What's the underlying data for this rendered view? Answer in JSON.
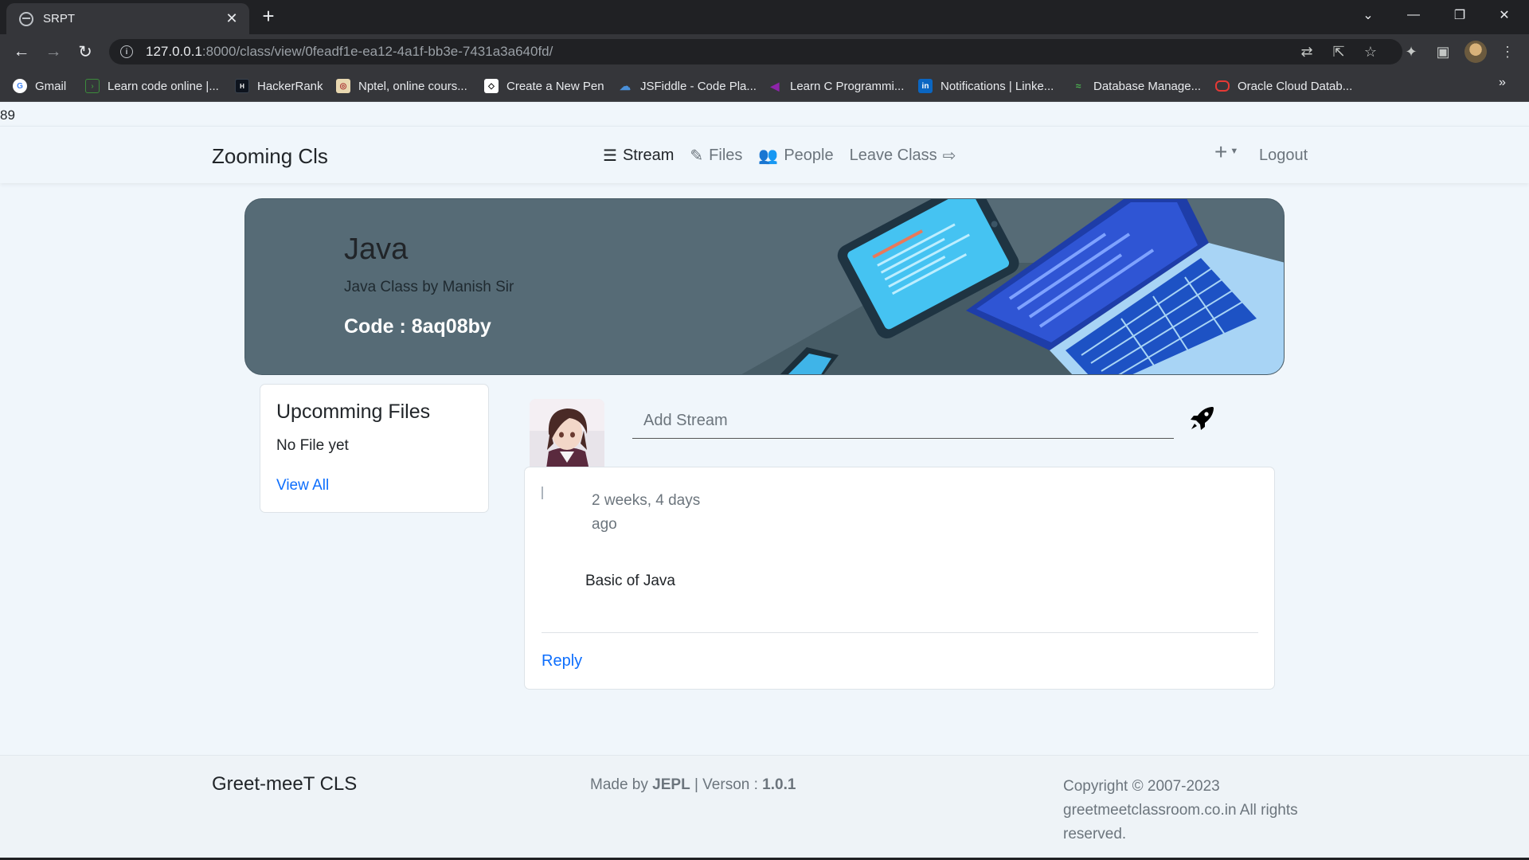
{
  "browser": {
    "tab_title": "SRPT",
    "tab_close": "✕",
    "new_tab": "+",
    "url_host": "127.0.0.1",
    "url_rest": ":8000/class/view/0feadf1e-ea12-4a1f-bb3e-7431a3a640fd/",
    "bookmarks": [
      {
        "label": "Gmail",
        "icon": "google-icon",
        "color": "#ffffff"
      },
      {
        "label": "Learn code online |...",
        "icon": "code-icon",
        "color": "#3c8c3c"
      },
      {
        "label": "HackerRank",
        "icon": "hackerrank-icon",
        "color": "#0e141e"
      },
      {
        "label": "Nptel, online cours...",
        "icon": "nptel-icon",
        "color": "#e8d7b0"
      },
      {
        "label": "Create a New Pen",
        "icon": "codepen-icon",
        "color": "#ffffff"
      },
      {
        "label": "JSFiddle - Code Pla...",
        "icon": "jsfiddle-icon",
        "color": "#1c75bc"
      },
      {
        "label": "Learn C Programmi...",
        "icon": "programiz-icon",
        "color": "#7b1fa2"
      },
      {
        "label": "Notifications | Linke...",
        "icon": "linkedin-icon",
        "color": "#0a66c2"
      },
      {
        "label": "Database Manage...",
        "icon": "database-icon",
        "color": "#4caf50"
      },
      {
        "label": "Oracle Cloud Datab...",
        "icon": "oracle-icon",
        "color": "#e53935"
      }
    ]
  },
  "stray_text": "89",
  "nav": {
    "brand": "Zooming Cls",
    "links": [
      {
        "label": "Stream",
        "icon": "bars-icon"
      },
      {
        "label": "Files",
        "icon": "file-edit-icon"
      },
      {
        "label": "People",
        "icon": "users-icon"
      },
      {
        "label": "Leave Class",
        "icon": "sign-out-icon"
      }
    ],
    "plus": "+",
    "logout": "Logout"
  },
  "banner": {
    "title": "Java",
    "subtitle": "Java Class by Manish Sir",
    "code": "Code : 8aq08by"
  },
  "files": {
    "title": "Upcomming Files",
    "empty": "No File yet",
    "view_all": "View All"
  },
  "stream": {
    "placeholder": "Add Stream"
  },
  "post": {
    "time": "2 weeks, 4 days ago",
    "text": "Basic of Java",
    "reply": "Reply"
  },
  "footer": {
    "brand": "Greet-meeT CLS",
    "made_prefix": "Made by ",
    "made_by": "JEPL",
    "version_prefix": " | Verson : ",
    "version": "1.0.1",
    "copyright": "Copyright © 2007-2023 greetmeetclassroom.co.in All rights reserved."
  },
  "colors": {
    "page_bg": "#f0f6fb",
    "banner_bg": "#566b76",
    "link": "#0d6efd",
    "chrome_dark": "#202124",
    "chrome_toolbar": "#35363a"
  }
}
